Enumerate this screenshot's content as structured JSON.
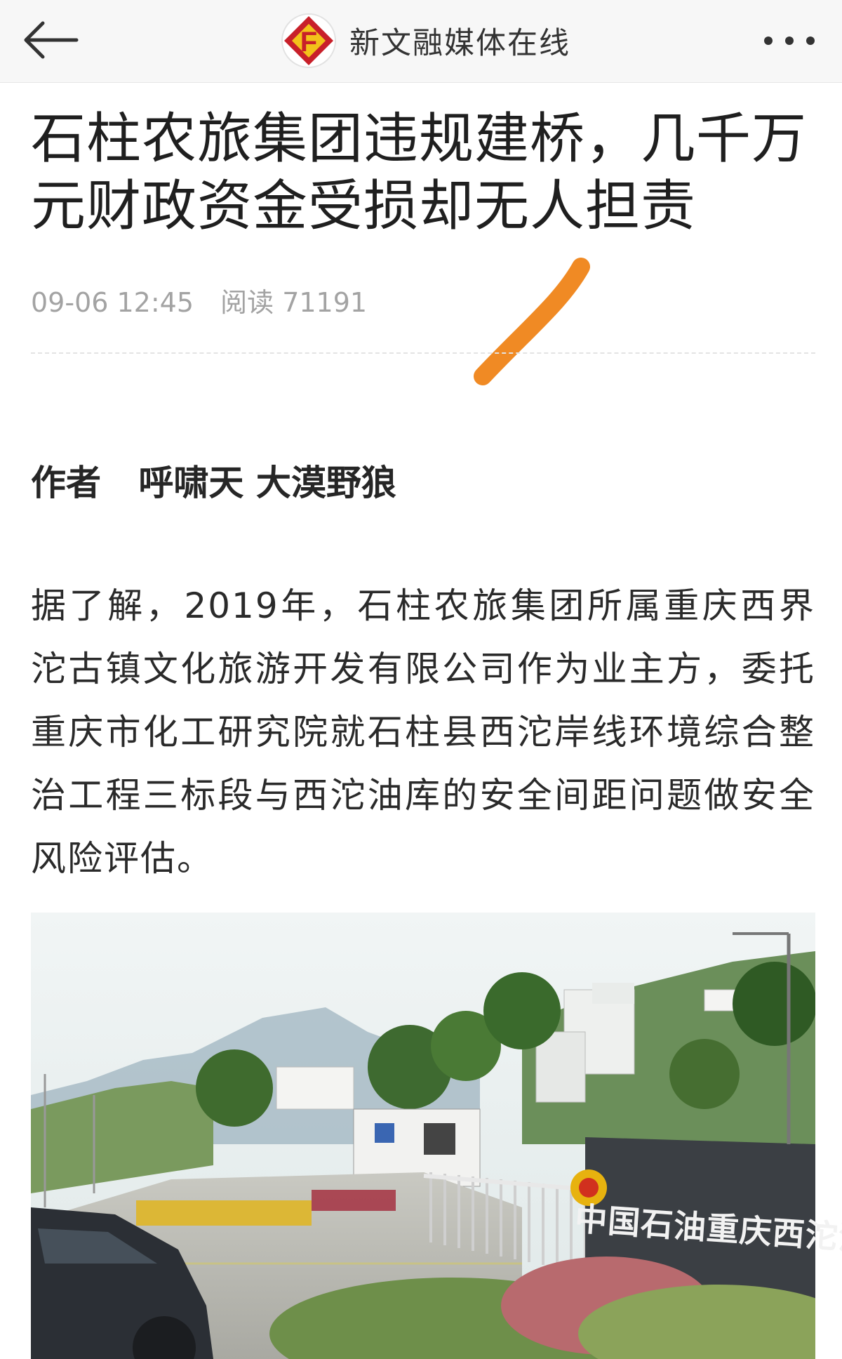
{
  "header": {
    "source_name": "新文融媒体在线",
    "logo_letter": "F",
    "icons": {
      "back": "arrow-left-icon",
      "more": "more-dots-icon"
    }
  },
  "article": {
    "title": "石柱农旅集团违规建桥，几千万元财政资金受损却无人担责",
    "date": "09-06 12:45",
    "reads": "阅读 71191",
    "author_label": "作者",
    "author_names": "呼啸天 大漠野狼",
    "paragraph": "据了解，2019年，石柱农旅集团所属重庆西界沱古镇文化旅游开发有限公司作为业主方，委托重庆市化工研究院就石柱县西沱岸线环境综合整治工程三标段与西沱油库的安全间距问题做安全风险评估。"
  },
  "photo": {
    "sign_text": "中国石油重庆西沱油"
  },
  "colors": {
    "topbar_bg": "#f7f7f7",
    "logo_red": "#c8202a",
    "logo_yellow": "#f3c21a",
    "scribble": "#f08a24",
    "meta_gray": "#a3a3a3"
  }
}
